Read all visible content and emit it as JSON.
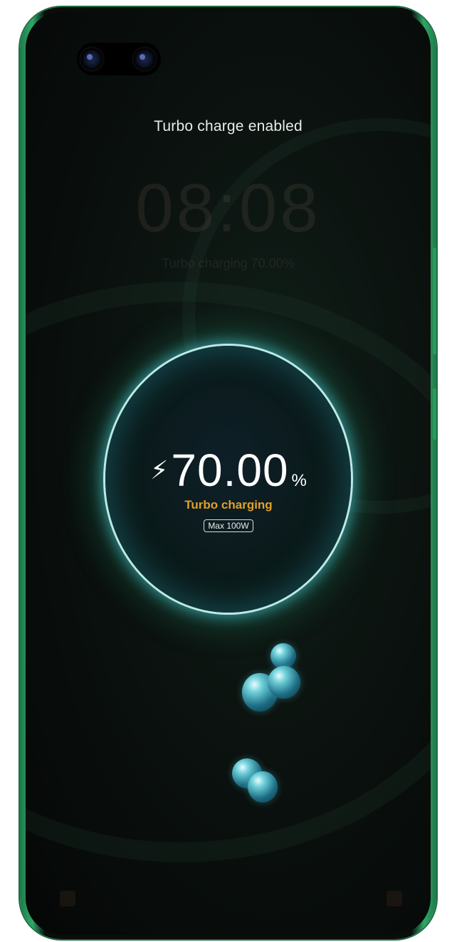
{
  "lockscreen": {
    "notice": "Turbo charge enabled",
    "clock_time": "08:08",
    "clock_subtitle": "Turbo charging 70.00%"
  },
  "charging": {
    "bolt_icon": "lightning-bolt-icon",
    "percent_value": "70.00",
    "percent_sign": "%",
    "mode_label": "Turbo charging",
    "max_power_badge": "Max 100W",
    "level_percent": 70
  },
  "colors": {
    "frame": "#2fa866",
    "ring_glow": "#50c8dc",
    "mode_label": "#e0a02a",
    "background": "#0a0d0c"
  }
}
